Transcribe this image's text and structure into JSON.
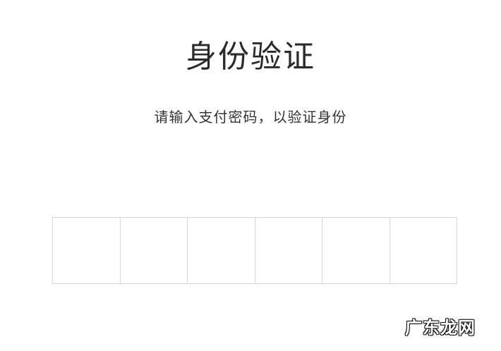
{
  "page": {
    "title": "身份验证",
    "subtitle": "请输入支付密码，以验证身份"
  },
  "pin": {
    "cells": [
      "",
      "",
      "",
      "",
      "",
      ""
    ]
  },
  "watermark": {
    "text": "广东龙网"
  }
}
